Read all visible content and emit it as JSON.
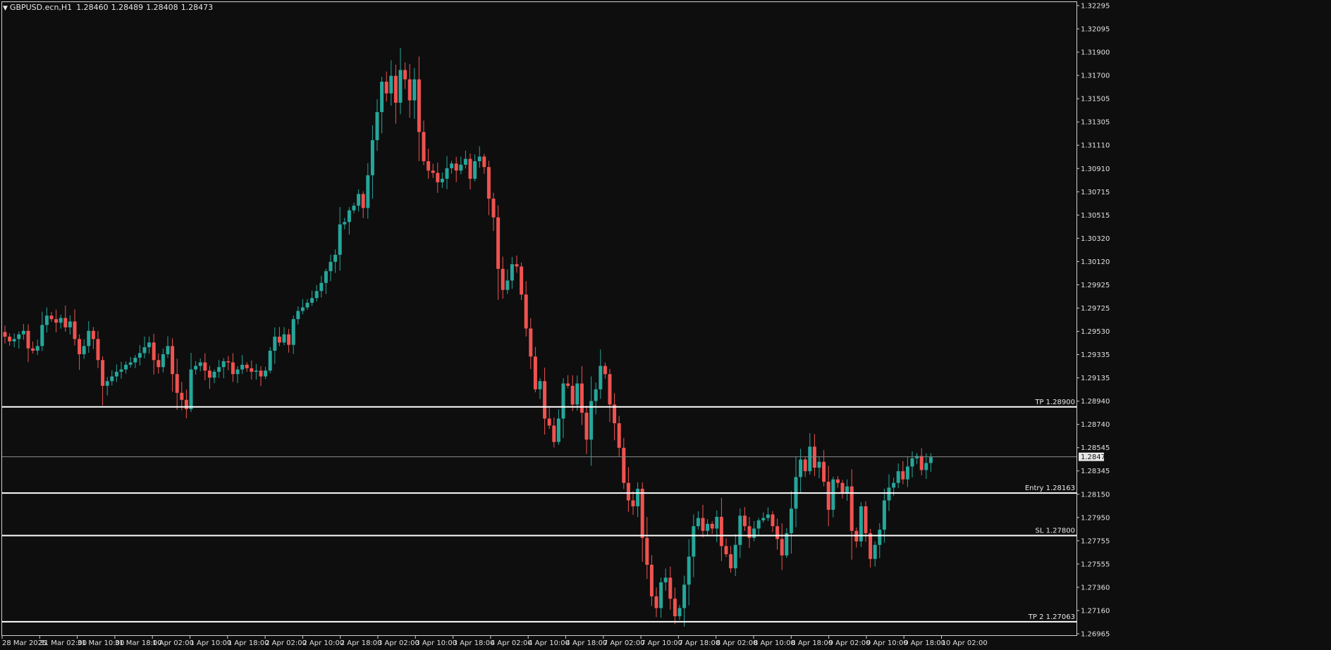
{
  "header": {
    "symbol": "GBPUSD.ecn,H1",
    "open": "1.28460",
    "high": "1.28489",
    "low": "1.28408",
    "close": "1.28473"
  },
  "colors": {
    "background": "#0e0e0e",
    "frame": "#d0d0d0",
    "bull": "#26a69a",
    "bear": "#ef5350",
    "level_line": "#ffffff",
    "current_price_line": "#8a8a8a",
    "text": "#e0e0e0"
  },
  "price_axis": {
    "labels": [
      "1.32295",
      "1.32095",
      "1.31900",
      "1.31700",
      "1.31505",
      "1.31305",
      "1.31110",
      "1.30910",
      "1.30715",
      "1.30515",
      "1.30320",
      "1.30120",
      "1.29925",
      "1.29725",
      "1.29530",
      "1.29335",
      "1.29135",
      "1.28940",
      "1.28740",
      "1.28545",
      "1.28345",
      "1.28150",
      "1.27950",
      "1.27755",
      "1.27555",
      "1.27360",
      "1.27160",
      "1.26965"
    ],
    "current_price_label": "1.28473"
  },
  "time_axis": {
    "labels": [
      "28 Mar 2025",
      "31 Mar 02:00",
      "31 Mar 10:00",
      "31 Mar 18:00",
      "1 Apr 02:00",
      "1 Apr 10:00",
      "1 Apr 18:00",
      "2 Apr 02:00",
      "2 Apr 10:00",
      "2 Apr 18:00",
      "3 Apr 02:00",
      "3 Apr 10:00",
      "3 Apr 18:00",
      "4 Apr 02:00",
      "4 Apr 10:00",
      "4 Apr 18:00",
      "7 Apr 02:00",
      "7 Apr 10:00",
      "7 Apr 18:00",
      "8 Apr 02:00",
      "8 Apr 10:00",
      "8 Apr 18:00",
      "9 Apr 02:00",
      "9 Apr 10:00",
      "9 Apr 18:00",
      "10 Apr 02:00"
    ]
  },
  "levels": [
    {
      "label": "TP 1.28900",
      "price": 1.289
    },
    {
      "label": "Entry 1.28163",
      "price": 1.28163
    },
    {
      "label": "SL 1.27800",
      "price": 1.278
    },
    {
      "label": "TP 2 1.27063",
      "price": 1.27063
    }
  ],
  "chart_data": {
    "type": "candlestick",
    "timeframe": "H1",
    "ylim": [
      1.2696,
      1.3233
    ],
    "closes": [
      1.295,
      1.2946,
      1.2948,
      1.2952,
      1.2955,
      1.294,
      1.2938,
      1.2942,
      1.296,
      1.2968,
      1.2965,
      1.2962,
      1.2966,
      1.2958,
      1.2963,
      1.2948,
      1.2935,
      1.2942,
      1.2955,
      1.2948,
      1.293,
      1.2908,
      1.2912,
      1.2916,
      1.292,
      1.2922,
      1.2926,
      1.2928,
      1.2932,
      1.2936,
      1.2941,
      1.2945,
      1.293,
      1.2924,
      1.2935,
      1.2942,
      1.2918,
      1.2902,
      1.2896,
      1.2888,
      1.2922,
      1.2925,
      1.2928,
      1.2921,
      1.2915,
      1.292,
      1.2924,
      1.2929,
      1.2928,
      1.2918,
      1.2922,
      1.2926,
      1.2923,
      1.292,
      1.2921,
      1.2916,
      1.2921,
      1.2938,
      1.295,
      1.2945,
      1.2952,
      1.2943,
      1.2965,
      1.2972,
      1.2975,
      1.2979,
      1.2983,
      1.2989,
      1.2996,
      1.3006,
      1.3014,
      1.302,
      1.3046,
      1.3048,
      1.3058,
      1.3062,
      1.3072,
      1.306,
      1.3088,
      1.3118,
      1.3142,
      1.3168,
      1.3158,
      1.3173,
      1.315,
      1.3178,
      1.317,
      1.3152,
      1.317,
      1.3125,
      1.31,
      1.3092,
      1.309,
      1.3082,
      1.3085,
      1.3094,
      1.3098,
      1.3092,
      1.3097,
      1.3102,
      1.3085,
      1.31,
      1.3104,
      1.3095,
      1.3068,
      1.3052,
      1.3008,
      1.299,
      1.2998,
      1.3012,
      1.301,
      1.2986,
      1.2957,
      1.2933,
      1.2905,
      1.2912,
      1.288,
      1.2874,
      1.286,
      1.288,
      1.291,
      1.2908,
      1.2892,
      1.291,
      1.2885,
      1.2862,
      1.2895,
      1.2905,
      1.2925,
      1.2918,
      1.2892,
      1.2876,
      1.2855,
      1.2825,
      1.281,
      1.2805,
      1.282,
      1.2778,
      1.2755,
      1.2728,
      1.2718,
      1.274,
      1.2744,
      1.2726,
      1.2711,
      1.2718,
      1.2738,
      1.2762,
      1.2788,
      1.2795,
      1.2784,
      1.279,
      1.2786,
      1.2796,
      1.2771,
      1.2764,
      1.2752,
      1.2772,
      1.2797,
      1.2788,
      1.2778,
      1.2786,
      1.2793,
      1.2795,
      1.2798,
      1.2788,
      1.2777,
      1.2763,
      1.2782,
      1.2803,
      1.283,
      1.2845,
      1.2835,
      1.2856,
      1.2838,
      1.2843,
      1.2826,
      1.2802,
      1.2828,
      1.2825,
      1.2816,
      1.2822,
      1.2784,
      1.2775,
      1.2805,
      1.2782,
      1.276,
      1.2772,
      1.2785,
      1.281,
      1.2821,
      1.2825,
      1.2835,
      1.2828,
      1.2839,
      1.2846,
      1.2848,
      1.2836,
      1.2842,
      1.2847
    ]
  }
}
